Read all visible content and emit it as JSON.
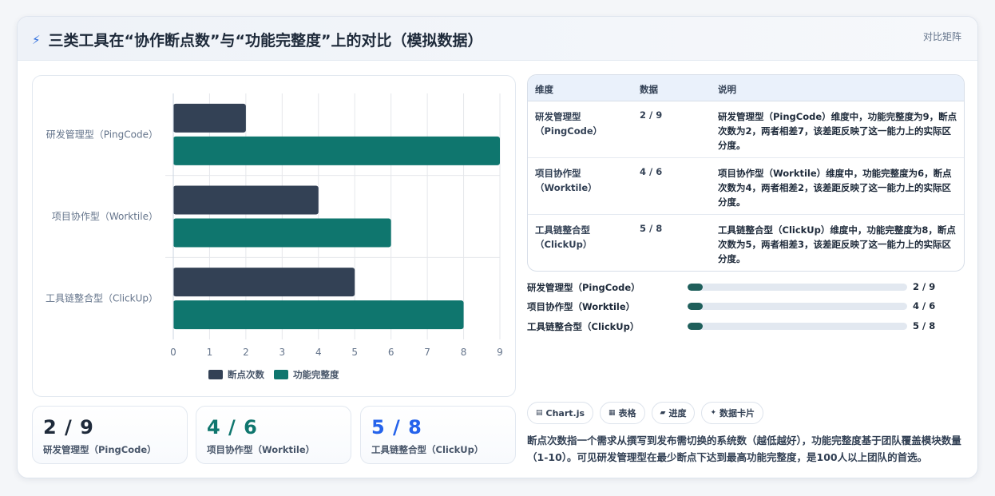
{
  "header": {
    "title": "三类工具在“协作断点数”与“功能完整度”上的对比（模拟数据）",
    "title_icon": "lightning-icon",
    "mode_label": "对比矩阵"
  },
  "chart_data": {
    "type": "bar",
    "orientation": "horizontal",
    "categories": [
      "研发管理型（PingCode）",
      "项目协作型（Worktile）",
      "工具链整合型（ClickUp）"
    ],
    "series": [
      {
        "name": "断点次数",
        "values": [
          2,
          4,
          5
        ],
        "color": "#334155"
      },
      {
        "name": "功能完整度",
        "values": [
          9,
          6,
          8
        ],
        "color": "#0f766e"
      }
    ],
    "xlim": [
      0,
      9
    ],
    "xticks": [
      "0",
      "1",
      "2",
      "3",
      "4",
      "5",
      "6",
      "7",
      "8",
      "9"
    ],
    "grid": true,
    "legend_position": "bottom"
  },
  "stats": [
    {
      "value": "2 / 9",
      "label": "研发管理型（PingCode）",
      "color": "#1e2a3a"
    },
    {
      "value": "4 / 6",
      "label": "项目协作型（Worktile）",
      "color": "#0f766e"
    },
    {
      "value": "5 / 8",
      "label": "工具链整合型（ClickUp）",
      "color": "#2563eb"
    }
  ],
  "table": {
    "headers": [
      "维度",
      "数据",
      "说明"
    ],
    "rows": [
      {
        "dim": "研发管理型（PingCode）",
        "data": "2 / 9",
        "desc": "研发管理型（PingCode）维度中，功能完整度为9，断点次数为2，两者相差7，该差距反映了这一能力上的实际区分度。"
      },
      {
        "dim": "项目协作型（Worktile）",
        "data": "4 / 6",
        "desc": "项目协作型（Worktile）维度中，功能完整度为6，断点次数为4，两者相差2，该差距反映了这一能力上的实际区分度。"
      },
      {
        "dim": "工具链整合型（ClickUp）",
        "data": "5 / 8",
        "desc": "工具链整合型（ClickUp）维度中，功能完整度为8，断点次数为5，两者相差3，该差距反映了这一能力上的实际区分度。"
      }
    ]
  },
  "progress": [
    {
      "label": "研发管理型（PingCode）",
      "value": "2 / 9",
      "fraction": 0.07
    },
    {
      "label": "项目协作型（Worktile）",
      "value": "4 / 6",
      "fraction": 0.07
    },
    {
      "label": "工具链整合型（ClickUp）",
      "value": "5 / 8",
      "fraction": 0.07
    }
  ],
  "tags": [
    {
      "icon": "chart-icon",
      "glyph": "▤",
      "label": "Chart.js"
    },
    {
      "icon": "table-icon",
      "glyph": "▦",
      "label": "表格"
    },
    {
      "icon": "progress-icon",
      "glyph": "▰",
      "label": "进度"
    },
    {
      "icon": "card-icon",
      "glyph": "✦",
      "label": "数据卡片"
    }
  ],
  "note": "断点次数指一个需求从撰写到发布需切换的系统数（越低越好），功能完整度基于团队覆盖模块数量（1-10）。可见研发管理型在最少断点下达到最高功能完整度，是100人以上团队的首选。"
}
